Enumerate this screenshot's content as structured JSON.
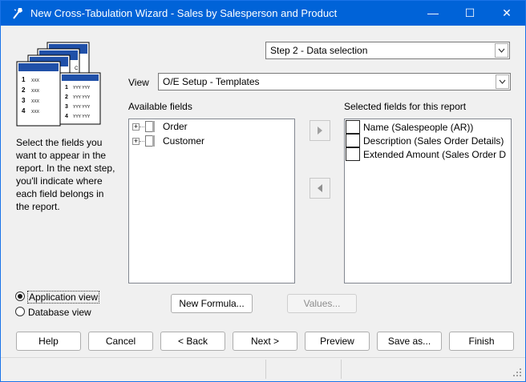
{
  "window": {
    "title": "New Cross-Tabulation Wizard - Sales by Salesperson and Product",
    "minimize_glyph": "—",
    "maximize_glyph": "☐",
    "close_glyph": "✕"
  },
  "step_select": {
    "value": "Step 2 - Data selection"
  },
  "view": {
    "label": "View",
    "value": "O/E Setup - Templates"
  },
  "description": "Select the fields you want to appear in the report. In the next step, you'll indicate where each field belongs in the report.",
  "available": {
    "label": "Available fields",
    "items": [
      {
        "label": "Order"
      },
      {
        "label": "Customer"
      }
    ]
  },
  "selected": {
    "label": "Selected fields for this report",
    "items": [
      {
        "label": "Name (Salespeople (AR))"
      },
      {
        "label": "Description (Sales Order Details)"
      },
      {
        "label": "Extended Amount (Sales Order D"
      }
    ]
  },
  "view_mode": {
    "application": "Application view",
    "database": "Database view",
    "selected": "application"
  },
  "buttons": {
    "new_formula": "New Formula...",
    "values": "Values...",
    "help": "Help",
    "cancel": "Cancel",
    "back": "< Back",
    "next": "Next >",
    "preview": "Preview",
    "save_as": "Save as...",
    "finish": "Finish"
  },
  "illustration": {
    "rows_left": [
      "1",
      "2",
      "3",
      "4"
    ],
    "rows_right": [
      "1",
      "2",
      "3",
      "4"
    ],
    "cell_short": "XXX",
    "cell_yy": "YYY YYY",
    "col_head": "AA",
    "col_c": "C"
  }
}
